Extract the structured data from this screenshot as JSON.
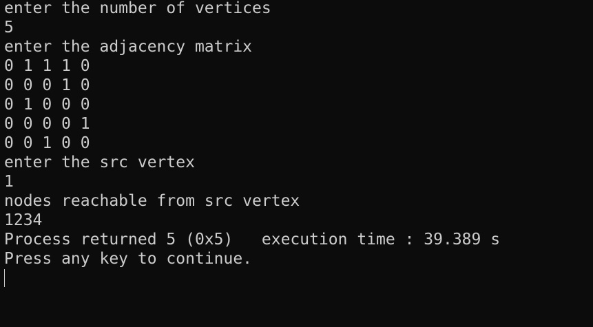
{
  "console": {
    "lines": [
      "enter the number of vertices",
      "5",
      "enter the adjacency matrix",
      "0 1 1 1 0",
      "0 0 0 1 0",
      "0 1 0 0 0",
      "0 0 0 0 1",
      "0 0 1 0 0",
      "enter the src vertex",
      "1",
      "nodes reachable from src vertex",
      "1234",
      "Process returned 5 (0x5)   execution time : 39.389 s",
      "Press any key to continue."
    ]
  },
  "colors": {
    "background": "#0c0c0c",
    "foreground": "#cccccc"
  }
}
